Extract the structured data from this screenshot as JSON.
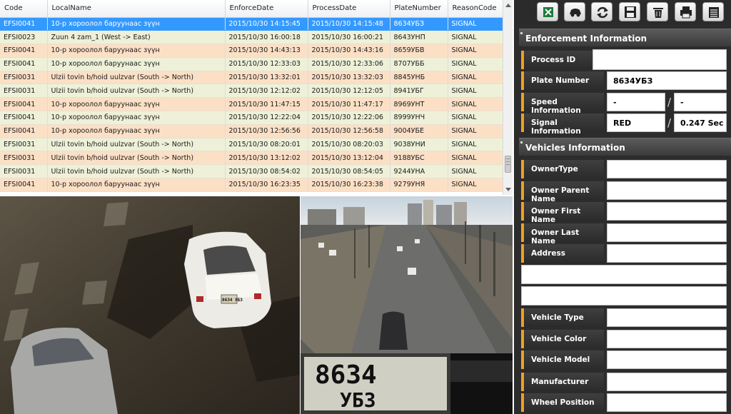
{
  "table": {
    "columns": [
      "Code",
      "LocalName",
      "EnforceDate",
      "ProcessDate",
      "PlateNumber",
      "ReasonCode"
    ],
    "rows": [
      [
        "EFSI0041",
        "10-р хороолол баруунаас зүүн",
        "2015/10/30 14:15:45",
        "2015/10/30 14:15:48",
        "8634УБЗ",
        "SIGNAL"
      ],
      [
        "EFSI0023",
        "Zuun 4 zam_1 (West -> East)",
        "2015/10/30 16:00:18",
        "2015/10/30 16:00:21",
        "8643УНП",
        "SIGNAL"
      ],
      [
        "EFSI0041",
        "10-р хороолол баруунаас зүүн",
        "2015/10/30 14:43:13",
        "2015/10/30 14:43:16",
        "8659УБВ",
        "SIGNAL"
      ],
      [
        "EFSI0041",
        "10-р хороолол баруунаас зүүн",
        "2015/10/30 12:33:03",
        "2015/10/30 12:33:06",
        "8707УББ",
        "SIGNAL"
      ],
      [
        "EFSI0031",
        "Ulzii tovin b/hoid uulzvar (South -> North)",
        "2015/10/30 13:32:01",
        "2015/10/30 13:32:03",
        "8845УНБ",
        "SIGNAL"
      ],
      [
        "EFSI0031",
        "Ulzii tovin b/hoid uulzvar (South -> North)",
        "2015/10/30 12:12:02",
        "2015/10/30 12:12:05",
        "8941УБГ",
        "SIGNAL"
      ],
      [
        "EFSI0041",
        "10-р хороолол баруунаас зүүн",
        "2015/10/30 11:47:15",
        "2015/10/30 11:47:17",
        "8969УНТ",
        "SIGNAL"
      ],
      [
        "EFSI0041",
        "10-р хороолол баруунаас зүүн",
        "2015/10/30 12:22:04",
        "2015/10/30 12:22:06",
        "8999УНЧ",
        "SIGNAL"
      ],
      [
        "EFSI0041",
        "10-р хороолол баруунаас зүүн",
        "2015/10/30 12:56:56",
        "2015/10/30 12:56:58",
        "9004УБЕ",
        "SIGNAL"
      ],
      [
        "EFSI0031",
        "Ulzii tovin b/hoid uulzvar (South -> North)",
        "2015/10/30 08:20:01",
        "2015/10/30 08:20:03",
        "9038УНИ",
        "SIGNAL"
      ],
      [
        "EFSI0031",
        "Ulzii tovin b/hoid uulzvar (South -> North)",
        "2015/10/30 13:12:02",
        "2015/10/30 13:12:04",
        "9188УБС",
        "SIGNAL"
      ],
      [
        "EFSI0031",
        "Ulzii tovin b/hoid uulzvar (South -> North)",
        "2015/10/30 08:54:02",
        "2015/10/30 08:54:05",
        "9244УНА",
        "SIGNAL"
      ],
      [
        "EFSI0041",
        "10-р хороолол баруунаас зүүн",
        "2015/10/30 16:23:35",
        "2015/10/30 16:23:38",
        "9279УНЯ",
        "SIGNAL"
      ]
    ]
  },
  "toolbar": {
    "icons": [
      "excel-icon",
      "car-icon",
      "refresh-icon",
      "save-icon",
      "trash-icon",
      "print-icon",
      "list-icon"
    ]
  },
  "enforcement": {
    "title": "Enforcement Information",
    "process_id_label": "Process ID",
    "process_id_value": "",
    "plate_label": "Plate Number",
    "plate_value": "8634УБЗ",
    "speed_label": "Speed Information",
    "speed_value1": "-",
    "speed_value2": "-",
    "signal_label": "Signal Information",
    "signal_value1": "RED",
    "signal_value2": "0.247 Sec"
  },
  "vehicles": {
    "title": "Vehicles Information",
    "owner_type_label": "OwnerType",
    "owner_parent_label": "Owner Parent Name",
    "owner_first_label": "Owner First Name",
    "owner_last_label": "Owner Last Name",
    "address_label": "Address",
    "vehicle_type_label": "Vehicle Type",
    "vehicle_color_label": "Vehicle Color",
    "vehicle_model_label": "Vehicle Model",
    "manufacturer_label": "Manufacturer",
    "wheel_position_label": "Wheel Position"
  },
  "images": {
    "left_plate_text": "8634 УБЗ",
    "crop_plate_line1": "8634",
    "crop_plate_line2": "УБЗ"
  },
  "colors": {
    "selected_row": "#3399ff",
    "row_even": "#fbe0c6",
    "row_odd": "#eef1d8",
    "label_accent": "#f0a020",
    "panel_bg": "#2c2c2c"
  }
}
